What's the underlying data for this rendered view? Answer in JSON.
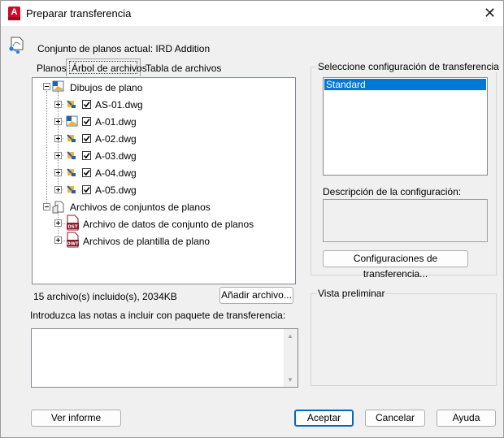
{
  "window": {
    "title": "Preparar transferencia",
    "close_glyph": "✕",
    "app_icon_letter": "A"
  },
  "header": {
    "current_set": "Conjunto de planos actual: IRD Addition"
  },
  "tabs": [
    {
      "label": "Planos"
    },
    {
      "label": "Árbol de archivos"
    },
    {
      "label": "Tabla de archivos"
    }
  ],
  "tree": {
    "drawings_group": "Dibujos de plano",
    "drawings": [
      {
        "name": "AS-01.dwg",
        "checked": true
      },
      {
        "name": "A-01.dwg",
        "checked": true
      },
      {
        "name": "A-02.dwg",
        "checked": true
      },
      {
        "name": "A-03.dwg",
        "checked": true
      },
      {
        "name": "A-04.dwg",
        "checked": true
      },
      {
        "name": "A-05.dwg",
        "checked": true
      }
    ],
    "sheetset_group": "Archivos de conjuntos de planos",
    "sheetset_files": [
      {
        "name": "Archivo de datos de conjunto de planos",
        "badge": "DST"
      },
      {
        "name": "Archivos de plantilla de plano",
        "badge": "DWT"
      }
    ]
  },
  "status": {
    "files_included": "15 archivo(s) incluido(s), 2034KB"
  },
  "buttons": {
    "add_file": "Añadir archivo...",
    "view_report": "Ver informe",
    "accept": "Aceptar",
    "cancel": "Cancelar",
    "help": "Ayuda",
    "transfer_configs": "Configuraciones de transferencia..."
  },
  "notes": {
    "label": "Introduzca las notas a incluir con paquete de transferencia:",
    "value": ""
  },
  "config": {
    "group_label": "Seleccione configuración de transferencia",
    "items": [
      "Standard"
    ],
    "selected": "Standard",
    "description_label": "Descripción de la configuración:",
    "description_value": ""
  },
  "preview": {
    "label": "Vista preliminar"
  },
  "colors": {
    "selection": "#0078d7",
    "primary_border": "#0067c0",
    "dst_badge": "#8b1a2b",
    "autocad_red": "#c8102e"
  }
}
